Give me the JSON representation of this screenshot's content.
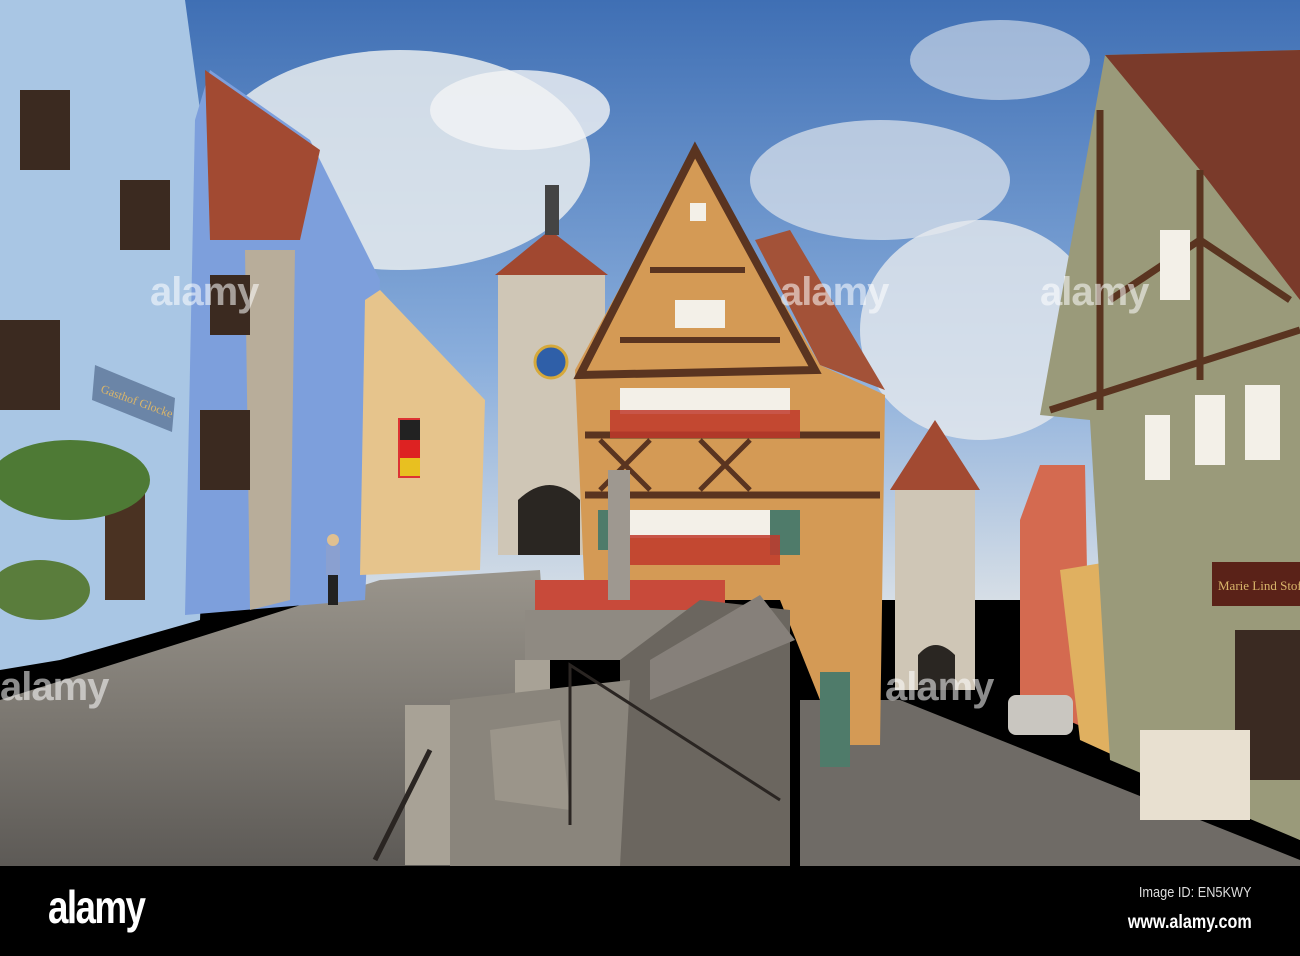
{
  "photo": {
    "signs": {
      "inn": "Gasthof Glocke",
      "shop": "Marie Lind Stoffe"
    },
    "watermark": "alamy"
  },
  "footer": {
    "logo": "alamy",
    "image_id": "Image ID: EN5KWY",
    "url": "www.alamy.com"
  },
  "colors": {
    "sky": "#5a86c4",
    "cobblestone": "#7d7a76",
    "timber_house": "#d49a55",
    "blue_house": "#7fa0dc"
  }
}
